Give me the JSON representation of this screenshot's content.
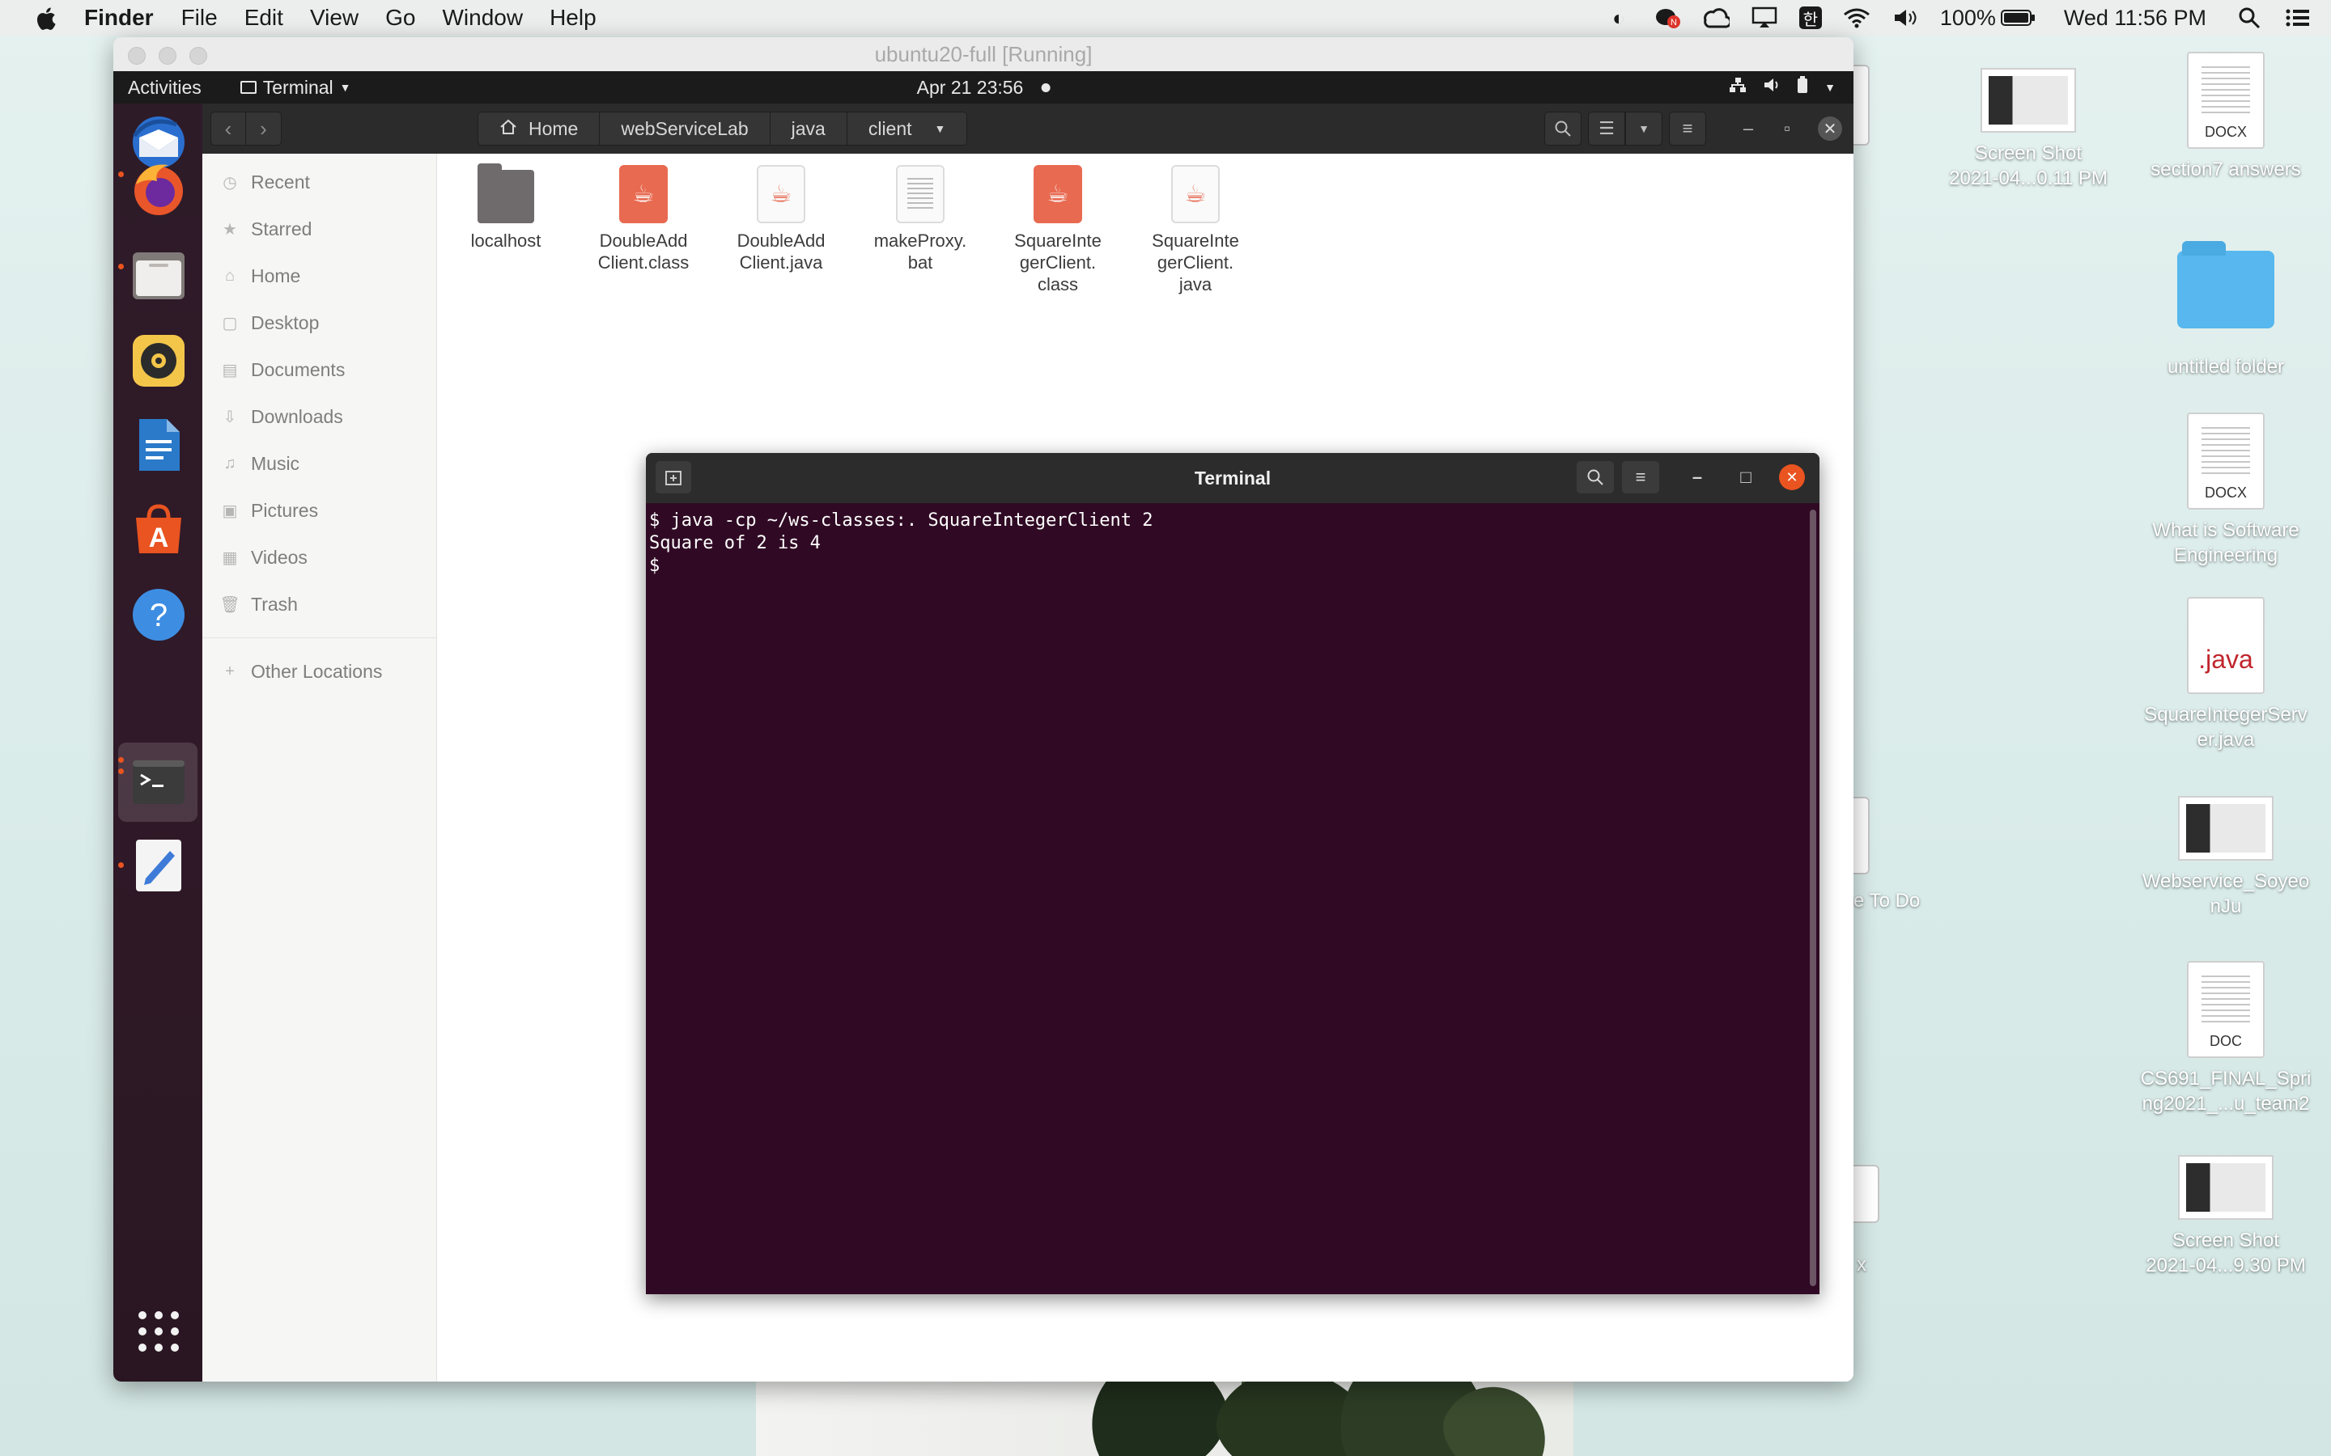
{
  "menubar": {
    "app": "Finder",
    "items": [
      "File",
      "Edit",
      "View",
      "Go",
      "Window",
      "Help"
    ],
    "battery": "100%",
    "clock": "Wed 11:56 PM",
    "status_icons": [
      "contrast-icon",
      "notification-badge-icon",
      "creative-cloud-icon",
      "airplay-icon",
      "input-korean-icon",
      "wifi-icon",
      "volume-icon",
      "battery-icon",
      "search-icon",
      "control-center-icon"
    ],
    "korean_glyph": "한"
  },
  "vm_window": {
    "title": "ubuntu20-full [Running]"
  },
  "ubuntu_topbar": {
    "activities": "Activities",
    "app_menu": "Terminal",
    "clock": "Apr 21  23:56"
  },
  "dock": {
    "apps": [
      "thunderbird-icon",
      "firefox-icon",
      "files-icon",
      "rhythmbox-icon",
      "libreoffice-writer-icon",
      "software-center-icon",
      "help-icon",
      "terminal-icon",
      "text-editor-icon"
    ]
  },
  "nautilus": {
    "path": [
      "Home",
      "webServiceLab",
      "java",
      "client"
    ],
    "sidebar": [
      {
        "label": "Recent",
        "icon": "clock-icon"
      },
      {
        "label": "Starred",
        "icon": "star-icon"
      },
      {
        "label": "Home",
        "icon": "home-icon"
      },
      {
        "label": "Desktop",
        "icon": "desktop-icon"
      },
      {
        "label": "Documents",
        "icon": "documents-icon"
      },
      {
        "label": "Downloads",
        "icon": "downloads-icon"
      },
      {
        "label": "Music",
        "icon": "music-icon"
      },
      {
        "label": "Pictures",
        "icon": "pictures-icon"
      },
      {
        "label": "Videos",
        "icon": "videos-icon"
      },
      {
        "label": "Trash",
        "icon": "trash-icon"
      }
    ],
    "other_locations": "Other Locations",
    "files": [
      {
        "line1": "localhost",
        "line2": "",
        "line3": ""
      },
      {
        "line1": "DoubleAdd",
        "line2": "Client.class",
        "line3": ""
      },
      {
        "line1": "DoubleAdd",
        "line2": "Client.java",
        "line3": ""
      },
      {
        "line1": "makeProxy.",
        "line2": "bat",
        "line3": ""
      },
      {
        "line1": "SquareInte",
        "line2": "gerClient.",
        "line3": "class"
      },
      {
        "line1": "SquareInte",
        "line2": "gerClient.",
        "line3": "java"
      }
    ]
  },
  "terminal": {
    "title": "Terminal",
    "lines": [
      "$ java -cp ~/ws-classes:. SquareIntegerClient 2",
      "Square of 2 is 4",
      "$"
    ]
  },
  "desktop": {
    "icons": [
      {
        "line1": "Screen Shot",
        "line2": "2021-04...0.11 PM"
      },
      {
        "line1": "section7 answers",
        "line2": ""
      },
      {
        "line1": "untitled folder",
        "line2": ""
      },
      {
        "line1": "What is Software",
        "line2": "Engineering"
      },
      {
        "line1": "SquareIntegerServ",
        "line2": "er.java"
      },
      {
        "line1": "Webservice_Soyeo",
        "line2": "nJu"
      },
      {
        "line1": "CS691_FINAL_Spri",
        "line2": "ng2021_...u_team2"
      },
      {
        "line1": "Screen Shot",
        "line2": "2021-04...9.30 PM"
      }
    ],
    "doc_tags": {
      "docx": "DOCX",
      "doc": "DOC",
      "java": ".java"
    },
    "partial_labels": [
      "e To Do",
      "x"
    ]
  }
}
